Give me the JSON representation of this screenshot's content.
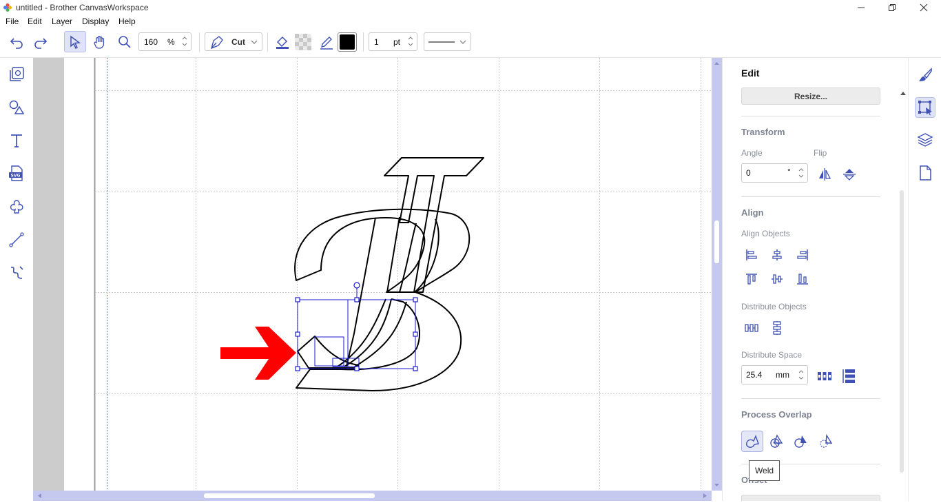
{
  "window": {
    "title": "untitled - Brother CanvasWorkspace"
  },
  "menu": {
    "file": "File",
    "edit": "Edit",
    "layer": "Layer",
    "display": "Display",
    "help": "Help"
  },
  "toolbar": {
    "zoom_value": "160",
    "zoom_unit": "%",
    "mode_label": "Cut",
    "line_width_value": "1",
    "line_width_unit": "pt",
    "fill_color": "#000000"
  },
  "panel": {
    "title": "Edit",
    "resize_label": "Resize...",
    "transform": {
      "heading": "Transform",
      "angle_label": "Angle",
      "angle_value": "0",
      "angle_unit": "°",
      "flip_label": "Flip"
    },
    "align": {
      "heading": "Align",
      "align_objects_label": "Align Objects",
      "distribute_objects_label": "Distribute Objects",
      "distribute_space_label": "Distribute Space",
      "distribute_space_value": "25.4",
      "distribute_space_unit": "mm"
    },
    "process_overlap": {
      "heading": "Process Overlap"
    },
    "offset": {
      "heading": "Offset"
    },
    "tooltip": "Weld"
  },
  "colors": {
    "accent": "#3f51b5",
    "scroll_track": "#c5c9f0",
    "arrow": "#ff0000",
    "selection": "#1a1acd"
  }
}
